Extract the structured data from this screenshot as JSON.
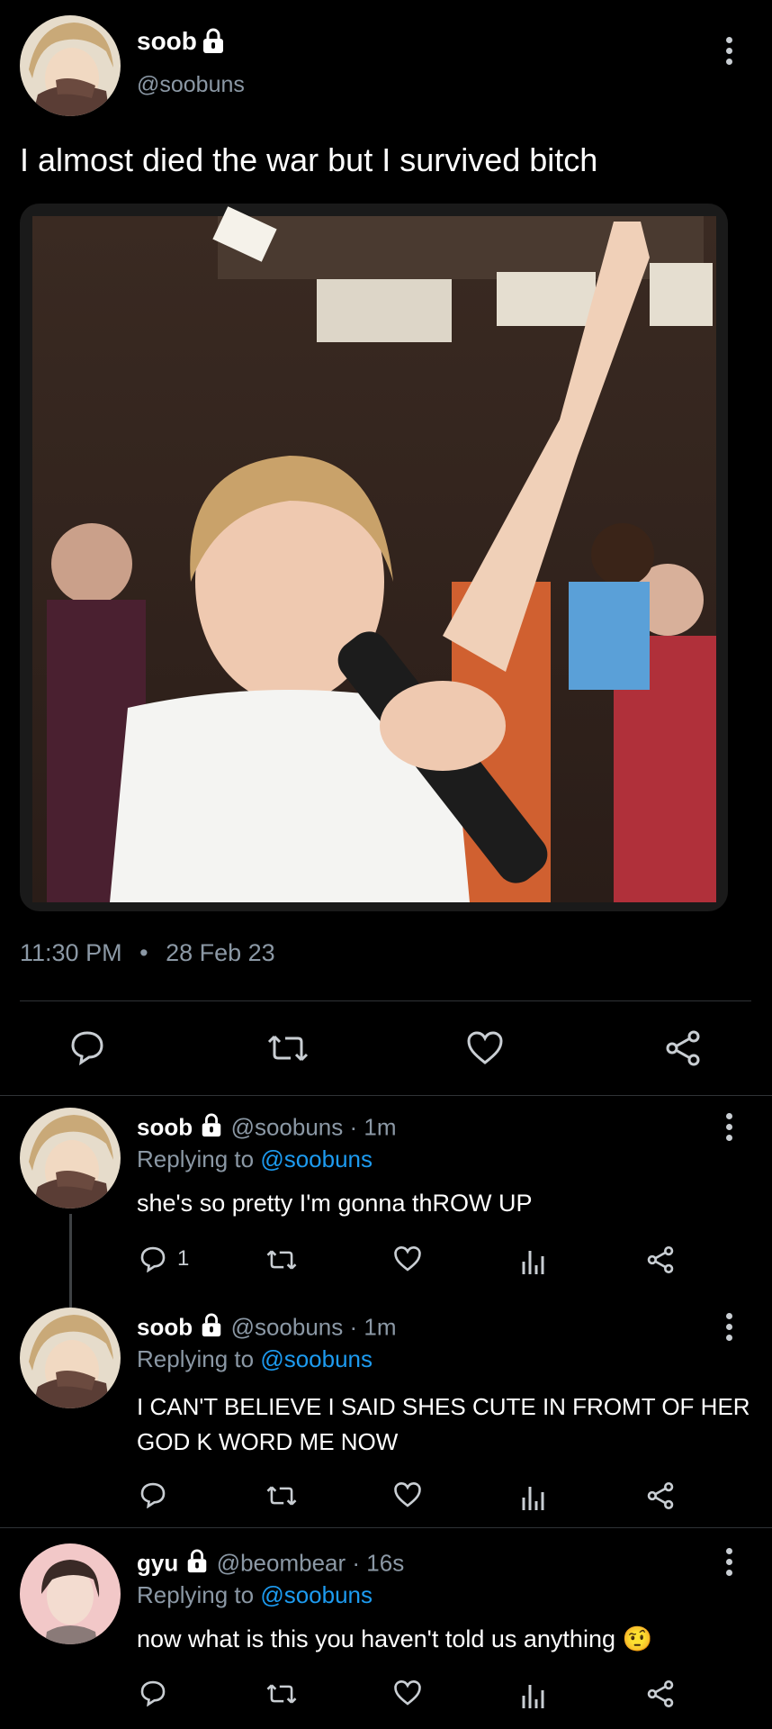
{
  "main_tweet": {
    "author_name": "soob",
    "author_handle": "@soobuns",
    "text": "I almost died the war but I survived bitch",
    "time": "11:30 PM",
    "dot": "•",
    "date": "28 Feb 23"
  },
  "replies": [
    {
      "author_name": "soob",
      "meta": "@soobuns · 1m",
      "replying_prefix": "Replying to",
      "replying_to": "@soobuns",
      "text": "she's so pretty I'm gonna thROW UP",
      "reply_count": "1"
    },
    {
      "author_name": "soob",
      "meta": "@soobuns · 1m",
      "replying_prefix": "Replying to",
      "replying_to": "@soobuns",
      "text_line1": "I CAN'T BELIEVE I SAID SHES CUTE IN FROMT OF HER",
      "text_line2": "GOD K WORD ME NOW"
    },
    {
      "author_name": "gyu",
      "meta": "@beombear · 16s",
      "replying_prefix": "Replying to",
      "replying_to": "@soobuns",
      "text": "now what is this you haven't told us anything",
      "emoji": "🤨"
    }
  ],
  "colors": {
    "background": "#000000",
    "link": "#1d9bf0",
    "muted": "#8b98a5",
    "icon": "#c9ced3"
  }
}
